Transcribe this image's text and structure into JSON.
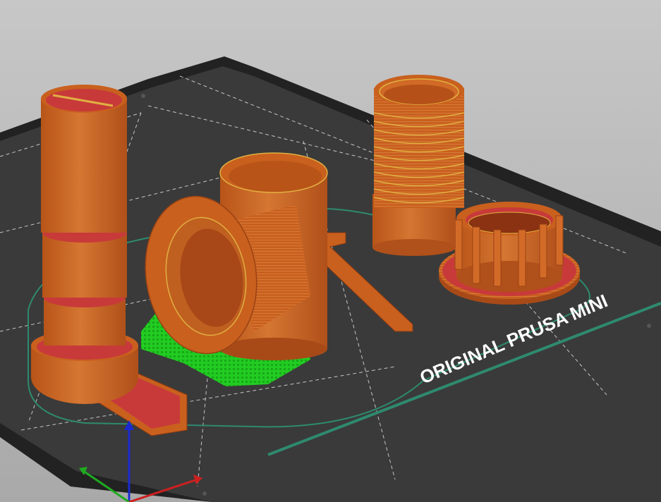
{
  "app": {
    "view": "3D print preview (sliced G-code)"
  },
  "bed": {
    "brand_text": "ORIGINAL PRUSA MINI",
    "surface_color": "#3a3a3a",
    "frame_color": "#222222",
    "grid_color": "#ffffff",
    "skirt_color": "#2e8a6e"
  },
  "colors": {
    "perimeter": "#c9601e",
    "perimeter_light": "#d97a36",
    "infill": "#c83a3a",
    "support": "#22cc22",
    "support_interface": "#1c9c1c",
    "layer_line": "#e0b040"
  },
  "axes": {
    "x_color": "#cc2020",
    "y_color": "#20aa20",
    "z_color": "#1a2ad0"
  },
  "objects": [
    {
      "name": "tall-stacked-cylinder"
    },
    {
      "name": "funnel-on-supports"
    },
    {
      "name": "threaded-tube"
    },
    {
      "name": "crenellated-ring"
    },
    {
      "name": "horizontal-rod"
    }
  ]
}
